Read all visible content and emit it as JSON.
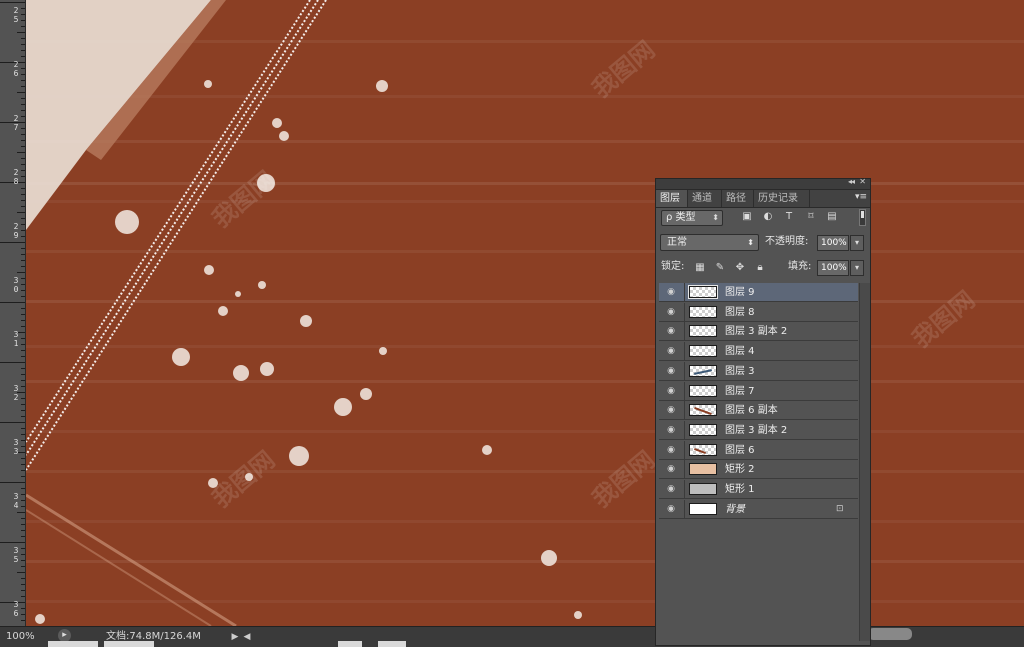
{
  "ruler": {
    "labels": [
      "2\n5",
      "2\n6",
      "2\n7",
      "2\n8",
      "2\n9",
      "3\n0",
      "3\n1",
      "3\n2",
      "3\n3",
      "3\n4",
      "3\n5",
      "3\n6"
    ]
  },
  "canvas": {
    "colors": {
      "background": "#8b3f24",
      "highlight": "#e9ddd4",
      "spots": "#f3ebe4"
    }
  },
  "status": {
    "zoom": "100%",
    "doc_info": "文档:74.8M/126.4M",
    "next_arrow": "▶",
    "prev_arrow": "◀"
  },
  "layers_panel": {
    "collapse_icon": "◂◂",
    "close_icon": "✕",
    "tabs": [
      {
        "label": "图层",
        "active": true
      },
      {
        "label": "通道",
        "active": false
      },
      {
        "label": "路径",
        "active": false
      },
      {
        "label": "历史记录",
        "active": false
      }
    ],
    "menu_icon": "▾≡",
    "filter": {
      "kind_label": "ρ 类型",
      "icons": [
        "image-filter-icon",
        "adjustment-filter-icon",
        "text-filter-icon",
        "shape-filter-icon",
        "smart-object-filter-icon"
      ]
    },
    "blend_mode": "正常",
    "opacity_label": "不透明度:",
    "opacity_value": "100%",
    "lock_label": "锁定:",
    "fill_label": "填充:",
    "fill_value": "100%",
    "layers": [
      {
        "name": "图层 9",
        "thumb": "checker-outline",
        "selected": true
      },
      {
        "name": "图层 8",
        "thumb": "checker"
      },
      {
        "name": "图层 3 副本 2",
        "thumb": "checker"
      },
      {
        "name": "图层 4",
        "thumb": "checker"
      },
      {
        "name": "图层 3",
        "thumb": "checker-line"
      },
      {
        "name": "图层 7",
        "thumb": "checker"
      },
      {
        "name": "图层 6 副本",
        "thumb": "checker-brown"
      },
      {
        "name": "图层 3 副本 2",
        "thumb": "checker"
      },
      {
        "name": "图层 6",
        "thumb": "checker-brown-small"
      },
      {
        "name": "矩形 2",
        "thumb": "solid-tan"
      },
      {
        "name": "矩形 1",
        "thumb": "solid-gray"
      },
      {
        "name": "背景",
        "thumb": "solid-white",
        "italic": true,
        "locked": true
      }
    ],
    "colors": {
      "panel": "#535353",
      "selected": "#5d6778",
      "tan": "#e8c0a2",
      "gray": "#bdbdbd"
    }
  },
  "watermark_text": "我图网"
}
